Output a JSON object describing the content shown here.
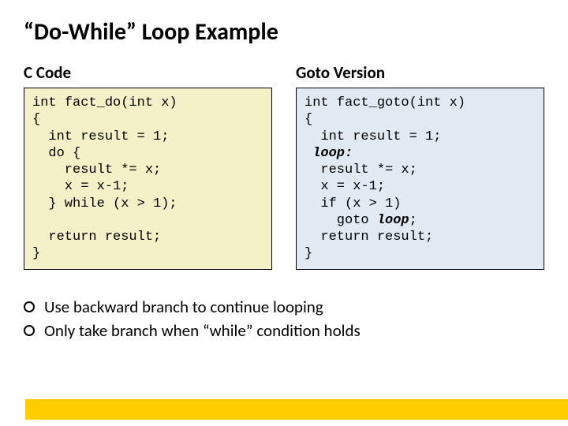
{
  "title": "“Do-While” Loop Example",
  "left": {
    "heading": "C Code",
    "l1": "int fact_do(int x)",
    "l2": "{",
    "l3": "  int result = 1;",
    "l4": "  do {",
    "l5": "    result *= x;",
    "l6": "    x = x-1;",
    "l7": "  } while (x > 1);",
    "l8": "",
    "l9": "  return result;",
    "l10": "}"
  },
  "right": {
    "heading": "Goto Version",
    "l1": "int fact_goto(int x)",
    "l2": "{",
    "l3": "  int result = 1;",
    "l4a": " ",
    "l4b": "loop:",
    "l5": "  result *= x;",
    "l6": "  x = x-1;",
    "l7": "  if (x > 1)",
    "l8a": "    goto ",
    "l8b": "loop",
    "l8c": ";",
    "l9": "  return result;",
    "l10": "}"
  },
  "bullets": {
    "b1": "Use backward branch to continue looping",
    "b2": "Only take branch when “while” condition holds"
  }
}
